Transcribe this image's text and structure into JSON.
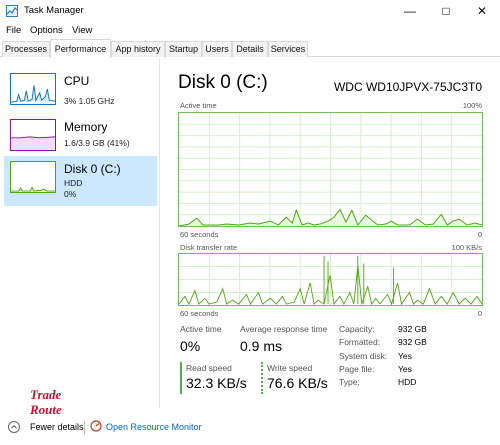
{
  "window": {
    "title": "Task Manager"
  },
  "menu": [
    "File",
    "Options",
    "View"
  ],
  "tabs": [
    "Processes",
    "Performance",
    "App history",
    "Startup",
    "Users",
    "Details",
    "Services"
  ],
  "sidebar": {
    "cpu": {
      "title": "CPU",
      "sub": "3%  1.05 GHz"
    },
    "memory": {
      "title": "Memory",
      "sub": "1.6/3.9 GB (41%)"
    },
    "disk": {
      "title": "Disk 0 (C:)",
      "type": "HDD",
      "pct": "0%"
    }
  },
  "main": {
    "title": "Disk 0 (C:)",
    "model": "WDC WD10JPVX-75JC3T0",
    "active_time": {
      "label": "Active time",
      "max": "100%",
      "duration": "60 seconds",
      "min": "0"
    },
    "transfer": {
      "label": "Disk transfer rate",
      "max": "100 KB/s",
      "duration": "60 seconds",
      "min": "0"
    }
  },
  "stats": {
    "active_time_label": "Active time",
    "active_time_value": "0%",
    "avg_resp_label": "Average response time",
    "avg_resp_value": "0.9 ms",
    "read_label": "Read speed",
    "read_value": "32.3 KB/s",
    "write_label": "Write speed",
    "write_value": "76.6 KB/s"
  },
  "properties": [
    {
      "label": "Capacity:",
      "value": "932 GB"
    },
    {
      "label": "Formatted:",
      "value": "932 GB"
    },
    {
      "label": "System disk:",
      "value": "Yes"
    },
    {
      "label": "Page file:",
      "value": "Yes"
    },
    {
      "label": "Type:",
      "value": "HDD"
    }
  ],
  "footer": {
    "fewer": "Fewer details",
    "resource_monitor": "Open Resource Monitor"
  },
  "logo": {
    "line1": "Trade",
    "line2": "Route"
  },
  "colors": {
    "cpu": "#1175c2",
    "memory": "#8b12ae",
    "disk": "#4da60c",
    "selected": "#cce8ff"
  },
  "icons": [
    "task-manager-icon",
    "minimize-icon",
    "maximize-icon",
    "close-icon",
    "chevron-up-icon",
    "resource-monitor-icon"
  ]
}
